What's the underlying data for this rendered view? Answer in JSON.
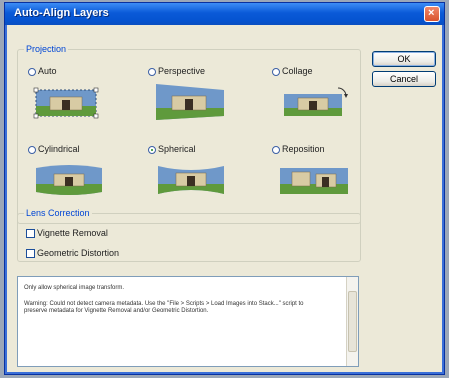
{
  "window": {
    "title": "Auto-Align Layers",
    "close_glyph": "×"
  },
  "projection": {
    "legend": "Projection",
    "options": [
      {
        "label": "Auto",
        "selected": false,
        "icon": "auto-preview"
      },
      {
        "label": "Perspective",
        "selected": false,
        "icon": "perspective-preview"
      },
      {
        "label": "Collage",
        "selected": false,
        "icon": "collage-preview"
      },
      {
        "label": "Cylindrical",
        "selected": false,
        "icon": "cylindrical-preview"
      },
      {
        "label": "Spherical",
        "selected": true,
        "icon": "spherical-preview"
      },
      {
        "label": "Reposition",
        "selected": false,
        "icon": "reposition-preview"
      }
    ]
  },
  "lens": {
    "legend": "Lens Correction",
    "vignette_label": "Vignette Removal",
    "vignette_checked": false,
    "distortion_label": "Geometric Distortion",
    "distortion_checked": false
  },
  "buttons": {
    "ok": "OK",
    "cancel": "Cancel"
  },
  "description": {
    "line1": "Only allow spherical image transform.",
    "line2": "Warning: Could not detect camera metadata. Use the \"File > Scripts > Load Images into Stack...\" script to preserve metadata for Vignette Removal and/or Geometric Distortion."
  },
  "colors": {
    "titlebar": "#0553d0",
    "dialog_bg": "#ece9d8",
    "group_label": "#0046d5",
    "sky": "#6f98c9",
    "grass": "#5f9a3c",
    "building": "#d8cba4"
  }
}
